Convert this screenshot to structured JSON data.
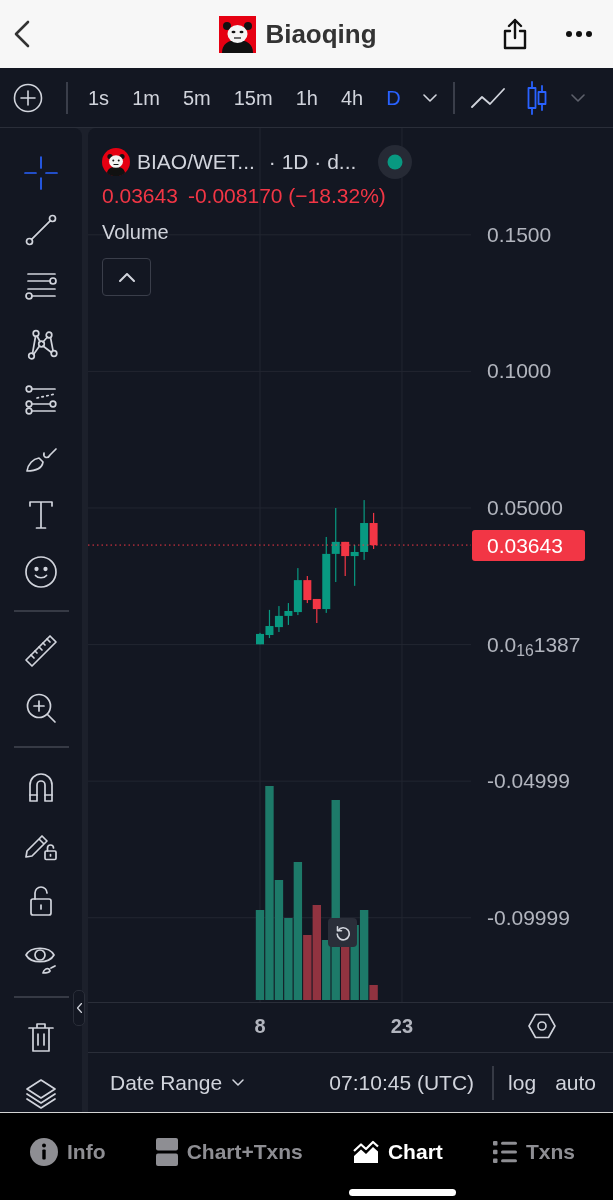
{
  "header": {
    "title": "Biaoqing"
  },
  "toolbar": {
    "intervals": [
      {
        "label": "1s",
        "selected": false
      },
      {
        "label": "1m",
        "selected": false
      },
      {
        "label": "5m",
        "selected": false
      },
      {
        "label": "15m",
        "selected": false
      },
      {
        "label": "1h",
        "selected": false
      },
      {
        "label": "4h",
        "selected": false
      },
      {
        "label": "D",
        "selected": true
      }
    ],
    "chart_types": [
      {
        "kind": "line",
        "selected": false
      },
      {
        "kind": "candles",
        "selected": true
      }
    ]
  },
  "tool_groups": [
    {
      "tools": [
        {
          "kind": "crosshair",
          "selected": true
        },
        {
          "kind": "trendline",
          "selected": false
        },
        {
          "kind": "channel",
          "selected": false
        },
        {
          "kind": "pattern",
          "selected": false
        },
        {
          "kind": "fib",
          "selected": false
        },
        {
          "kind": "brush",
          "selected": false
        },
        {
          "kind": "text",
          "selected": false
        },
        {
          "kind": "emoji",
          "selected": false
        }
      ]
    },
    {
      "tools": [
        {
          "kind": "ruler",
          "selected": false
        },
        {
          "kind": "zoom",
          "selected": false
        }
      ]
    },
    {
      "tools": [
        {
          "kind": "magnet",
          "selected": false
        },
        {
          "kind": "drawlock",
          "selected": false
        },
        {
          "kind": "lock",
          "selected": false
        },
        {
          "kind": "visibility",
          "selected": false
        }
      ]
    },
    {
      "tools": [
        {
          "kind": "trash",
          "selected": false
        },
        {
          "kind": "layers",
          "selected": false
        }
      ]
    }
  ],
  "chart": {
    "legend": {
      "symbol": "BIAO/WET...",
      "details": "· 1D · d...",
      "price": "0.03643",
      "change": "-0.008170 (−18.32%)",
      "indicator": "Volume"
    },
    "last_price": "0.03643",
    "chart_data": {
      "type": "candlestick",
      "x": [
        8,
        9,
        10,
        11,
        12,
        13,
        14,
        15,
        16,
        17,
        18,
        19,
        20
      ],
      "ohlc": [
        [
          0.0001,
          0.0043,
          0.0001,
          0.0039
        ],
        [
          0.0035,
          0.0127,
          0.0024,
          0.0068
        ],
        [
          0.0064,
          0.0141,
          0.0046,
          0.0105
        ],
        [
          0.0105,
          0.0152,
          0.0072,
          0.0123
        ],
        [
          0.0119,
          0.028,
          0.0108,
          0.0236
        ],
        [
          0.0236,
          0.0251,
          0.0152,
          0.0163
        ],
        [
          0.0167,
          0.0167,
          0.0079,
          0.013
        ],
        [
          0.013,
          0.0394,
          0.0116,
          0.0332
        ],
        [
          0.0332,
          0.05,
          0.0229,
          0.0376
        ],
        [
          0.0376,
          0.0376,
          0.0251,
          0.0324
        ],
        [
          0.0324,
          0.0365,
          0.0215,
          0.0339
        ],
        [
          0.0339,
          0.0529,
          0.031,
          0.0445
        ],
        [
          0.0445,
          0.0482,
          0.035,
          0.0364
        ]
      ],
      "xlim": [
        -10.17,
        45.29
      ],
      "ylim": [
        -0.1711,
        0.1891
      ],
      "xticks": [
        {
          "value": 8,
          "label": "8"
        },
        {
          "value": 23,
          "label": "23"
        }
      ],
      "yticks": [
        {
          "value": 0.15,
          "label": "0.1500"
        },
        {
          "value": 0.1,
          "label": "0.1000"
        },
        {
          "value": 0.05,
          "label": "0.05000"
        },
        {
          "value": 0,
          "label": "0.0$_{16}$1387"
        },
        {
          "value": -0.04999,
          "label": "-0.04999"
        },
        {
          "value": -0.09999,
          "label": "-0.09999"
        }
      ],
      "grid": true,
      "ref_lines": [
        {
          "axis": "y",
          "value": 0.03643,
          "color": "#f23645"
        }
      ]
    }
  },
  "footer": {
    "date_range": "Date Range",
    "clock": "07:10:45 (UTC)",
    "scale_options": [
      "log",
      "auto"
    ]
  },
  "tab_bar": [
    {
      "kind": "info",
      "label": "Info",
      "selected": false
    },
    {
      "kind": "split",
      "label": "Chart+Txns",
      "selected": false
    },
    {
      "kind": "chart",
      "label": "Chart",
      "selected": true
    },
    {
      "kind": "list",
      "label": "Txns",
      "selected": false
    }
  ]
}
